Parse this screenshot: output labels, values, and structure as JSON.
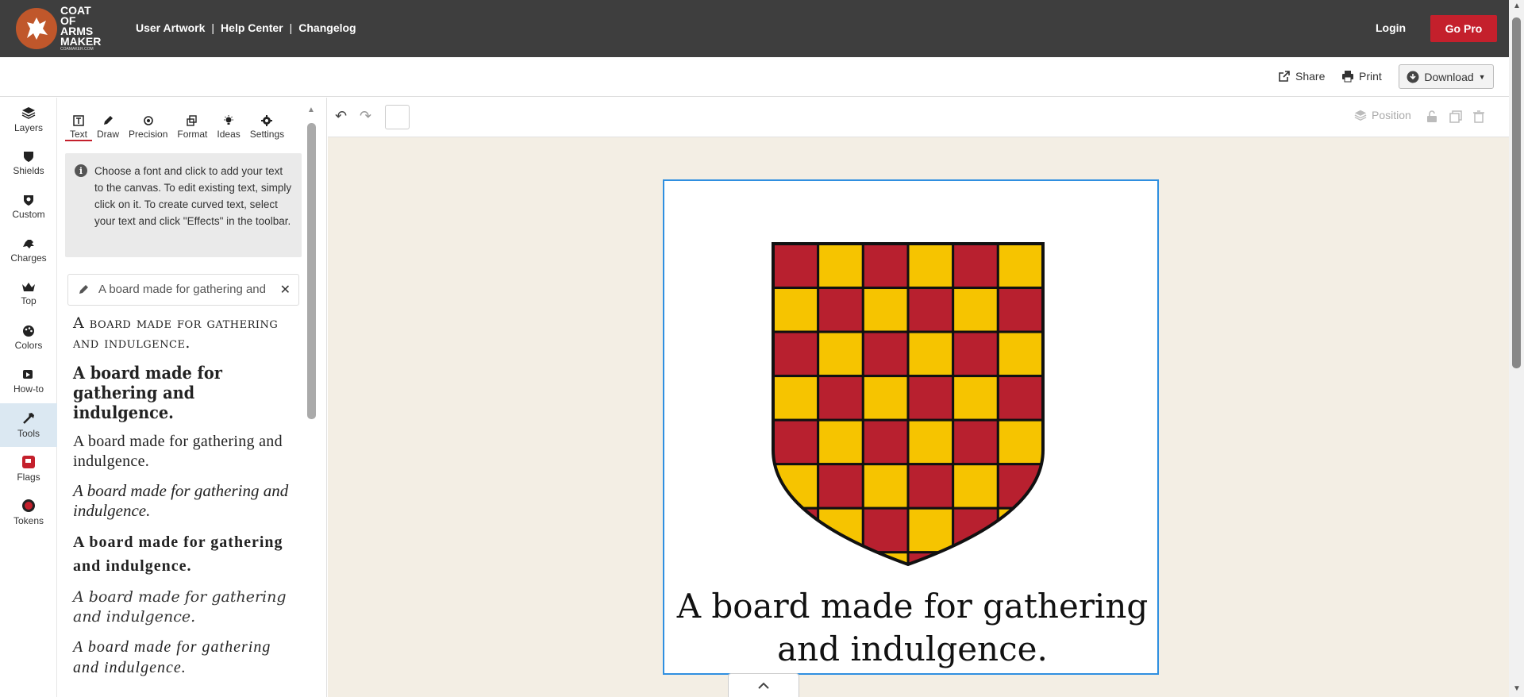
{
  "header": {
    "logo_lines": [
      "COAT OF",
      "ARMS",
      "MAKER"
    ],
    "logo_sub": "COAMAKER.COM",
    "nav": [
      "User Artwork",
      "Help Center",
      "Changelog"
    ],
    "login": "Login",
    "gopro": "Go Pro"
  },
  "actions": {
    "share": "Share",
    "print": "Print",
    "download": "Download"
  },
  "rail": [
    {
      "label": "Layers",
      "icon": "layers-icon"
    },
    {
      "label": "Shields",
      "icon": "shield-icon"
    },
    {
      "label": "Custom",
      "icon": "custom-shield-icon"
    },
    {
      "label": "Charges",
      "icon": "lion-icon"
    },
    {
      "label": "Top",
      "icon": "crown-icon"
    },
    {
      "label": "Colors",
      "icon": "palette-icon"
    },
    {
      "label": "How-to",
      "icon": "video-icon"
    },
    {
      "label": "Tools",
      "icon": "hammer-icon"
    },
    {
      "label": "Flags",
      "icon": "flag-icon"
    },
    {
      "label": "Tokens",
      "icon": "token-icon"
    }
  ],
  "tabs": [
    "Text",
    "Draw",
    "Precision",
    "Format",
    "Ideas",
    "Settings"
  ],
  "help_text": "Choose a font and click to add your text to the canvas. To edit existing text, simply click on it. To create curved text, select your text and click \"Effects\" in the toolbar.",
  "text_input": {
    "value": "A board made for gathering and indulgence."
  },
  "samples": [
    "A board made for gathering and indulgence.",
    "A board made for gathering and indulgence.",
    "A board made for gathering and indulgence.",
    "A board made for gathering and indulgence.",
    "A board made for gathering and indulgence.",
    "A board made for gathering and indulgence.",
    "A board made for gathering and indulgence."
  ],
  "toolbar": {
    "position": "Position"
  },
  "artboard": {
    "line1": "A board made for gathering",
    "line2": "and indulgence.",
    "colors": {
      "red": "#b8202f",
      "gold": "#f6c400",
      "outline": "#111111"
    }
  }
}
